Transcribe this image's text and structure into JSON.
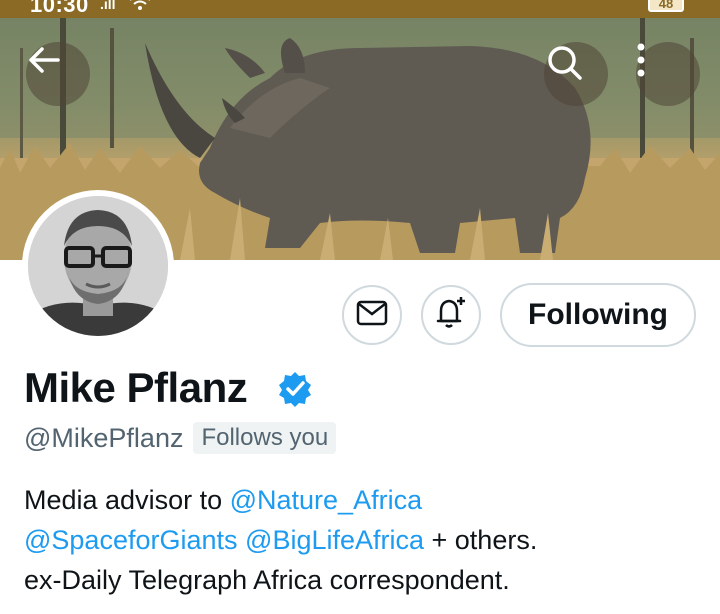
{
  "status_bar": {
    "time": "10:30",
    "signal": ".ıll",
    "battery": "48"
  },
  "header": {
    "back_icon": "arrow-left-icon",
    "search_icon": "search-icon",
    "more_icon": "more-vertical-icon"
  },
  "profile": {
    "name": "Mike Pflanz",
    "handle": "@MikePflanz",
    "follows_you": "Follows you",
    "verified": true,
    "bio": {
      "prefix": "Media advisor to ",
      "mention1": "@Nature_Africa",
      "mention2": "@SpaceforGiants",
      "mention3": "@BigLifeAfrica",
      "middle": " + others.",
      "line3": "ex-Daily Telegraph Africa correspondent."
    }
  },
  "actions": {
    "following_label": "Following",
    "message_icon": "mail-icon",
    "notify_icon": "bell-plus-icon"
  },
  "colors": {
    "link": "#1d9bf0",
    "verified": "#1d9bf0",
    "border": "#cfd9de"
  }
}
